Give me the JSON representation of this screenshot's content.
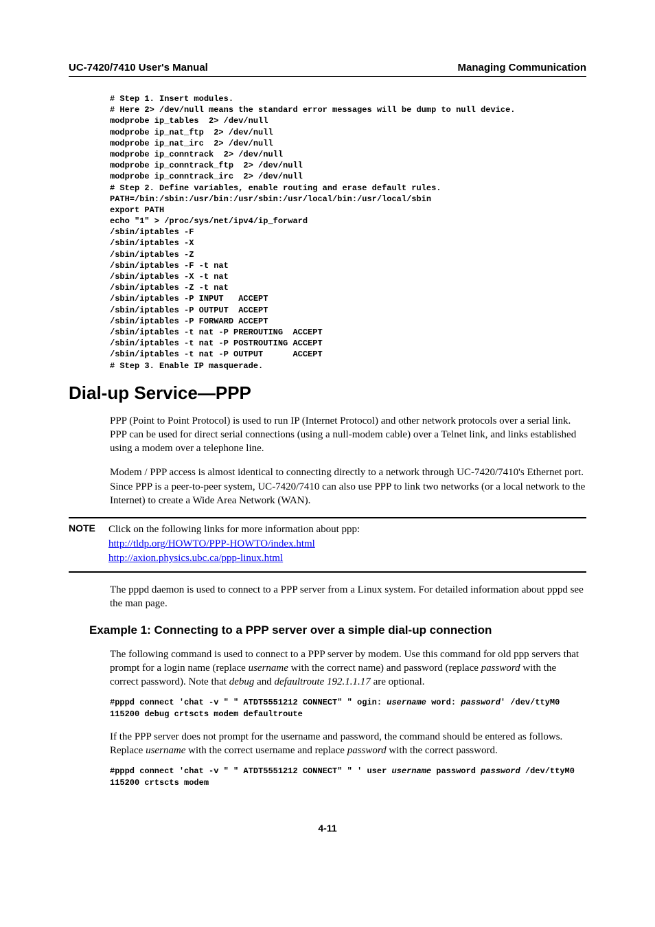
{
  "header": {
    "left": "UC-7420/7410 User's Manual",
    "right": "Managing Communication"
  },
  "code1": "# Step 1. Insert modules.\n# Here 2> /dev/null means the standard error messages will be dump to null device.\nmodprobe ip_tables  2> /dev/null\nmodprobe ip_nat_ftp  2> /dev/null\nmodprobe ip_nat_irc  2> /dev/null\nmodprobe ip_conntrack  2> /dev/null\nmodprobe ip_conntrack_ftp  2> /dev/null\nmodprobe ip_conntrack_irc  2> /dev/null\n# Step 2. Define variables, enable routing and erase default rules.\nPATH=/bin:/sbin:/usr/bin:/usr/sbin:/usr/local/bin:/usr/local/sbin\nexport PATH\necho \"1\" > /proc/sys/net/ipv4/ip_forward\n/sbin/iptables -F\n/sbin/iptables -X\n/sbin/iptables -Z\n/sbin/iptables -F -t nat\n/sbin/iptables -X -t nat\n/sbin/iptables -Z -t nat\n/sbin/iptables -P INPUT   ACCEPT\n/sbin/iptables -P OUTPUT  ACCEPT\n/sbin/iptables -P FORWARD ACCEPT\n/sbin/iptables -t nat -P PREROUTING  ACCEPT\n/sbin/iptables -t nat -P POSTROUTING ACCEPT\n/sbin/iptables -t nat -P OUTPUT      ACCEPT\n# Step 3. Enable IP masquerade.",
  "h1": "Dial-up Service—PPP",
  "para1": "PPP (Point to Point Protocol) is used to run IP (Internet Protocol) and other network protocols over a serial link. PPP can be used for direct serial connections (using a null-modem cable) over a Telnet link, and links established using a modem over a telephone line.",
  "para2": "Modem / PPP access is almost identical to connecting directly to a network through UC-7420/7410's Ethernet port. Since PPP is a peer-to-peer system, UC-7420/7410 can also use PPP to link two networks (or a local network to the Internet) to create a Wide Area Network (WAN).",
  "note": {
    "label": "NOTE",
    "intro": "Click on the following links for more information about ppp:",
    "link1": "http://tldp.org/HOWTO/PPP-HOWTO/index.html",
    "link2": "http://axion.physics.ubc.ca/ppp-linux.html"
  },
  "para3": "The pppd daemon is used to connect to a PPP server from a Linux system. For detailed information about pppd see the man page.",
  "h2": "Example 1: Connecting to a PPP server over a simple dial-up connection",
  "ex1": {
    "p1a": "The following command is used to connect to a PPP server by modem. Use this command for old ppp servers that prompt for a login name (replace ",
    "p1b": "username",
    "p1c": " with the correct name) and password (replace ",
    "p1d": "password",
    "p1e": " with the correct password). Note that ",
    "p1f": "debug",
    "p1g": " and ",
    "p1h": "defaultroute 192.1.1.17",
    "p1i": " are optional."
  },
  "cmd1": {
    "a": "#pppd connect 'chat -v \" \" ATDT5551212 CONNECT\" \" ogin: ",
    "b": "username",
    "c": " word: ",
    "d": "password",
    "e": "' /dev/ttyM0 115200 debug crtscts modem defaultroute"
  },
  "ex2": {
    "p1a": "If the PPP server does not prompt for the username and password, the command should be entered as follows. Replace ",
    "p1b": "username",
    "p1c": " with the correct username and replace ",
    "p1d": "password",
    "p1e": " with the correct password."
  },
  "cmd2": {
    "a": "#pppd connect 'chat -v \" \" ATDT5551212 CONNECT\" \" ' user ",
    "b": "username",
    "c": " password ",
    "d": "password",
    "e": " /dev/ttyM0 115200 crtscts modem"
  },
  "pagenum": "4-11"
}
